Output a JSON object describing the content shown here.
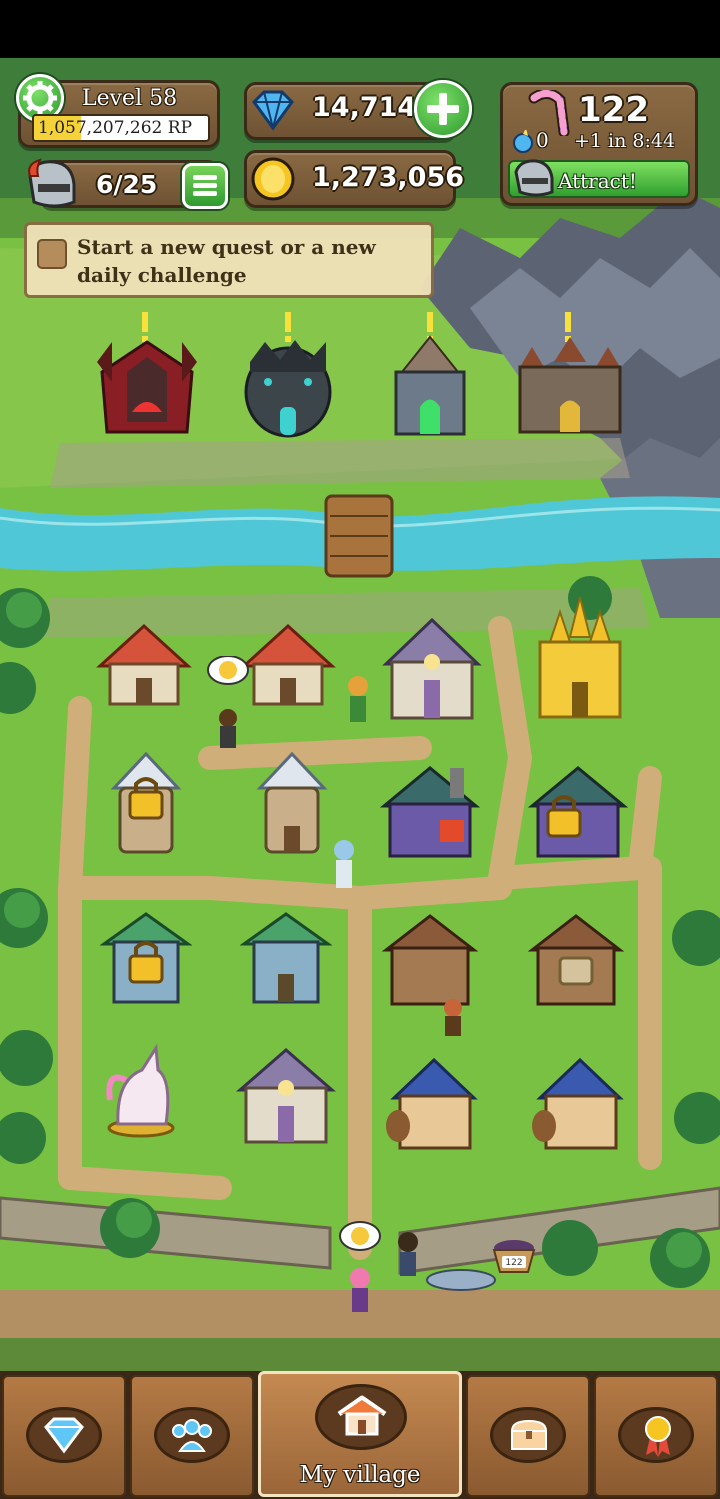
{
  "hud": {
    "level_label": "Level 58",
    "rp_text": "1,057,207,262 RP",
    "rp_progress": 0.27,
    "heroes_count": "6/25",
    "gems": "14,714",
    "gold": "1,273,056",
    "candy": "122",
    "candy_pending": "0",
    "candy_timer": "+1 in 8:44",
    "attract_label": "Attract!"
  },
  "quest": {
    "text": "Start a new quest or a new daily challenge"
  },
  "map": {
    "basket_count": "122"
  },
  "nav": {
    "tabs": [
      {
        "icon": "gem-icon",
        "label": ""
      },
      {
        "icon": "heroes-icon",
        "label": ""
      },
      {
        "icon": "house-icon",
        "label": "My village"
      },
      {
        "icon": "chest-icon",
        "label": ""
      },
      {
        "icon": "medal-icon",
        "label": ""
      }
    ]
  },
  "colors": {
    "grass": "#79c142",
    "river": "#4fc7d6",
    "path": "#cfae7a",
    "hud_wood": "#7a5b39",
    "button_green": "#3fb33a"
  }
}
